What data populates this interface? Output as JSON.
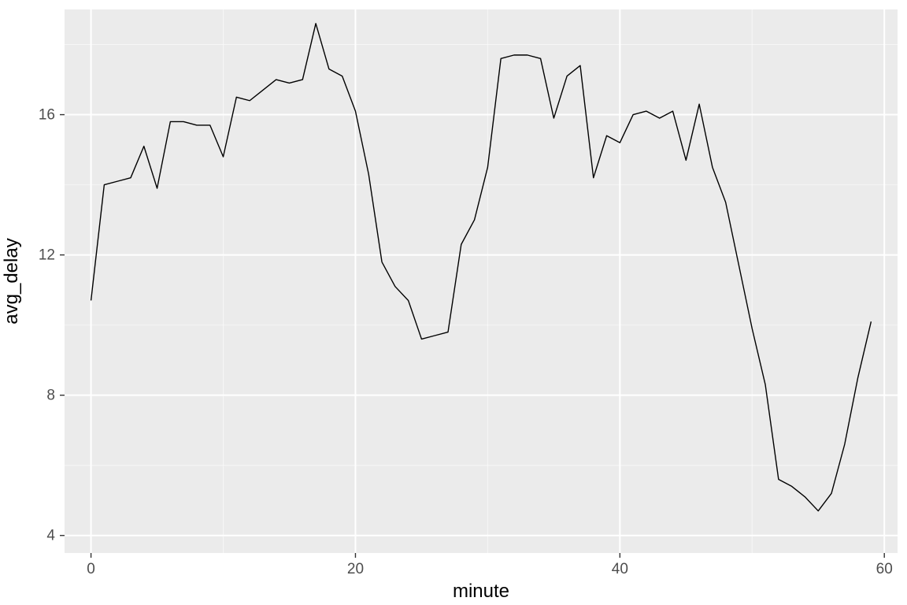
{
  "chart_data": {
    "type": "line",
    "xlabel": "minute",
    "ylabel": "avg_delay",
    "title": "",
    "xlim": [
      -2,
      61
    ],
    "ylim": [
      3.5,
      19
    ],
    "x_ticks": [
      0,
      20,
      40,
      60
    ],
    "y_ticks": [
      4,
      8,
      12,
      16
    ],
    "x": [
      0,
      1,
      2,
      3,
      4,
      5,
      6,
      7,
      8,
      9,
      10,
      11,
      12,
      13,
      14,
      15,
      16,
      17,
      18,
      19,
      20,
      21,
      22,
      23,
      24,
      25,
      26,
      27,
      28,
      29,
      30,
      31,
      32,
      33,
      34,
      35,
      36,
      37,
      38,
      39,
      40,
      41,
      42,
      43,
      44,
      45,
      46,
      47,
      48,
      49,
      50,
      51,
      52,
      53,
      54,
      55,
      56,
      57,
      58,
      59
    ],
    "values": [
      10.7,
      14.0,
      14.1,
      14.2,
      15.1,
      13.9,
      15.8,
      15.8,
      15.7,
      15.7,
      14.8,
      16.5,
      16.4,
      16.7,
      17.0,
      16.9,
      17.0,
      18.6,
      17.3,
      17.1,
      16.1,
      14.3,
      11.8,
      11.1,
      10.7,
      9.6,
      9.7,
      9.8,
      12.3,
      13.0,
      14.5,
      17.6,
      17.7,
      17.7,
      17.6,
      15.9,
      17.1,
      17.4,
      14.2,
      15.4,
      15.2,
      16.0,
      16.1,
      15.9,
      16.1,
      14.7,
      16.3,
      14.5,
      13.5,
      11.7,
      9.9,
      8.3,
      5.6,
      5.4,
      5.1,
      4.7,
      5.2,
      6.6,
      8.5,
      10.1
    ]
  },
  "axis": {
    "x_label": "minute",
    "y_label": "avg_delay",
    "x_tick_labels": [
      "0",
      "20",
      "40",
      "60"
    ],
    "y_tick_labels": [
      "4",
      "8",
      "12",
      "16"
    ]
  }
}
